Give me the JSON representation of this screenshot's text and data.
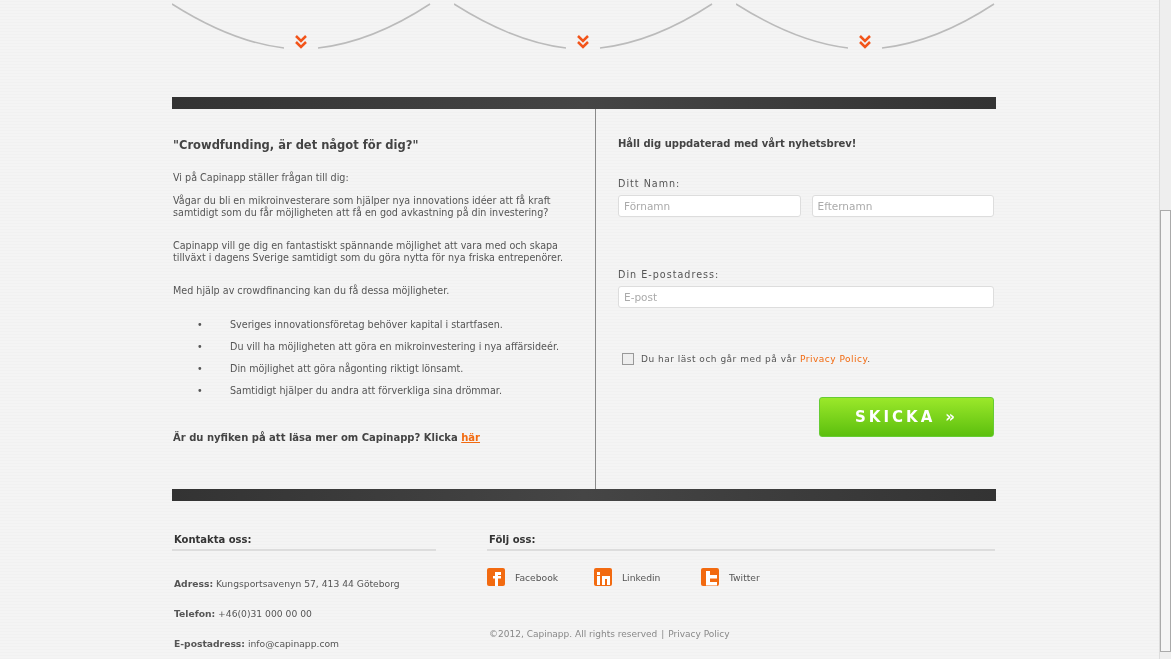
{
  "intro": {
    "heading": "\"Crowdfunding, är det något för dig?\"",
    "paragraphs": [
      "Vi på Capinapp ställer frågan till dig:",
      "Vågar du bli en mikroinvesterare som hjälper nya innovations idéer att få kraft samtidigt som du får möjligheten att få en god avkastning på din investering?",
      "Capinapp vill ge dig en fantastiskt spännande möjlighet att vara med och skapa tillväxt i dagens Sverige samtidigt som du göra nytta för nya friska entrepenörer.",
      "Med hjälp av crowdfinancing kan du få dessa möjligheter."
    ],
    "bullet_marker": "•",
    "bullets": [
      "Sveriges innovationsföretag behöver kapital i startfasen.",
      "Du vill ha möjligheten att göra en mikroinvestering i nya affärsideér.",
      "Din möjlighet att göra någonting riktigt lönsamt.",
      "Samtidigt hjälper du andra att förverkliga sina drömmar."
    ],
    "read_more": {
      "text": "Är du nyfiken på att läsa mer om Capinapp? Klicka",
      "link": "här"
    }
  },
  "newsletter": {
    "heading": "Håll dig uppdaterad med vårt nyhetsbrev!",
    "name_label": "Ditt Namn:",
    "first_name": {
      "placeholder": "Förnamn"
    },
    "last_name": {
      "placeholder": "Efternamn"
    },
    "email_label": "Din E-postadress:",
    "email": {
      "placeholder": "E-post"
    },
    "consent": {
      "checked": false,
      "text": "Du har läst och går med på vår",
      "link": "Privacy Policy",
      "end": "."
    },
    "submit": {
      "label": "SKICKA",
      "icon": "»"
    }
  },
  "contact": {
    "heading": "Kontakta oss:",
    "rows": [
      {
        "label": "Adress:",
        "value": "Kungsportsavenyn 57, 413 44 Göteborg"
      },
      {
        "label": "Telefon:",
        "value": "+46(0)31 000 00 00"
      },
      {
        "label": "E-postadress:",
        "value": "info@capinapp.com"
      }
    ]
  },
  "follow": {
    "heading": "Följ oss:",
    "links": [
      {
        "kind": "facebook",
        "label": "Facebook"
      },
      {
        "kind": "linkedin",
        "label": "Linkedin"
      },
      {
        "kind": "twitter",
        "label": "Twitter"
      }
    ],
    "copyright": "©2012, Capinapp. All rights reserved",
    "separator": "|",
    "policy": "Privacy Policy"
  }
}
